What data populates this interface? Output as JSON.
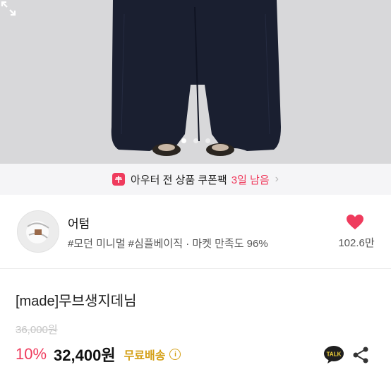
{
  "gallery": {
    "slide_count": 3,
    "active_index": 0
  },
  "coupon": {
    "text": "아우터 전 상품 쿠폰팩",
    "days_left": "3일 남음",
    "accent": "#ef3b5d"
  },
  "store": {
    "name": "어텀",
    "tags": "#모던 미니멀 #심플베이직 · 마켓 만족도 96%",
    "likes": "102.6만"
  },
  "product": {
    "name": "[made]무브생지데님",
    "original_price": "36,000원",
    "discount": "10%",
    "price": "32,400원",
    "shipping": "무료배송"
  },
  "colors": {
    "accent": "#ef3b5d",
    "shipping": "#d4a017"
  }
}
